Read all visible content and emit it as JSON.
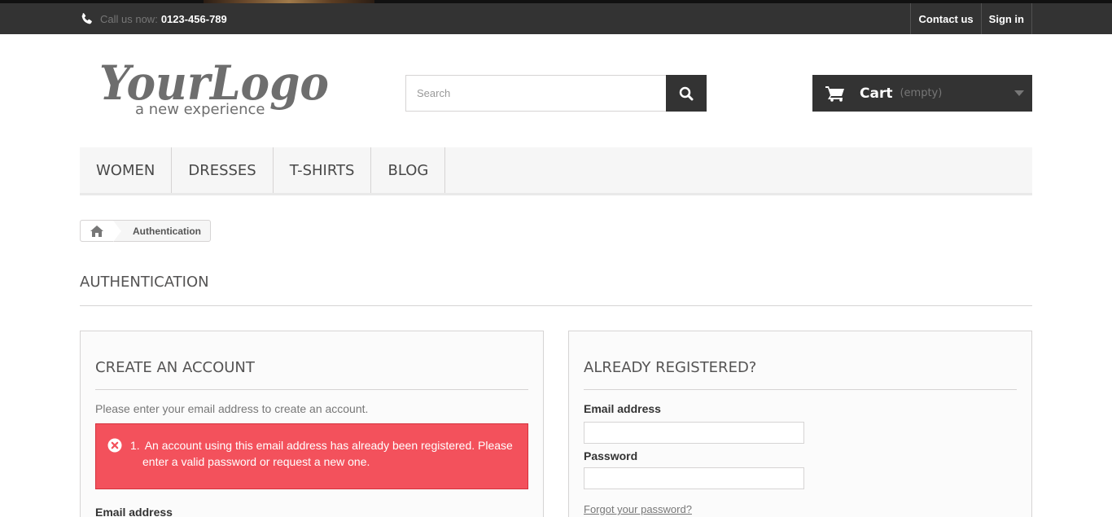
{
  "topbar": {
    "call_label": "Call us now:",
    "phone": "0123-456-789",
    "links": [
      "Contact us",
      "Sign in"
    ]
  },
  "header": {
    "logo_main": "YourLogo",
    "logo_tagline": "a new experience",
    "search_placeholder": "Search",
    "cart_label": "Cart",
    "cart_status": "(empty)"
  },
  "menu": {
    "items": [
      "WOMEN",
      "DRESSES",
      "T-SHIRTS",
      "BLOG"
    ]
  },
  "breadcrumb": {
    "current": "Authentication"
  },
  "page_title": "AUTHENTICATION",
  "create_account": {
    "title": "CREATE AN ACCOUNT",
    "intro": "Please enter your email address to create an account.",
    "error_number": "1.",
    "error_text": "An account using this email address has already been registered. Please enter a valid password or request a new one.",
    "email_label": "Email address"
  },
  "login": {
    "title": "ALREADY REGISTERED?",
    "email_label": "Email address",
    "email_value": "",
    "password_label": "Password",
    "password_value": "",
    "forgot_link": "Forgot your password?"
  },
  "colors": {
    "dark_bar": "#333333",
    "error_bg": "#f3515c",
    "menu_bg": "#f6f6f6"
  }
}
